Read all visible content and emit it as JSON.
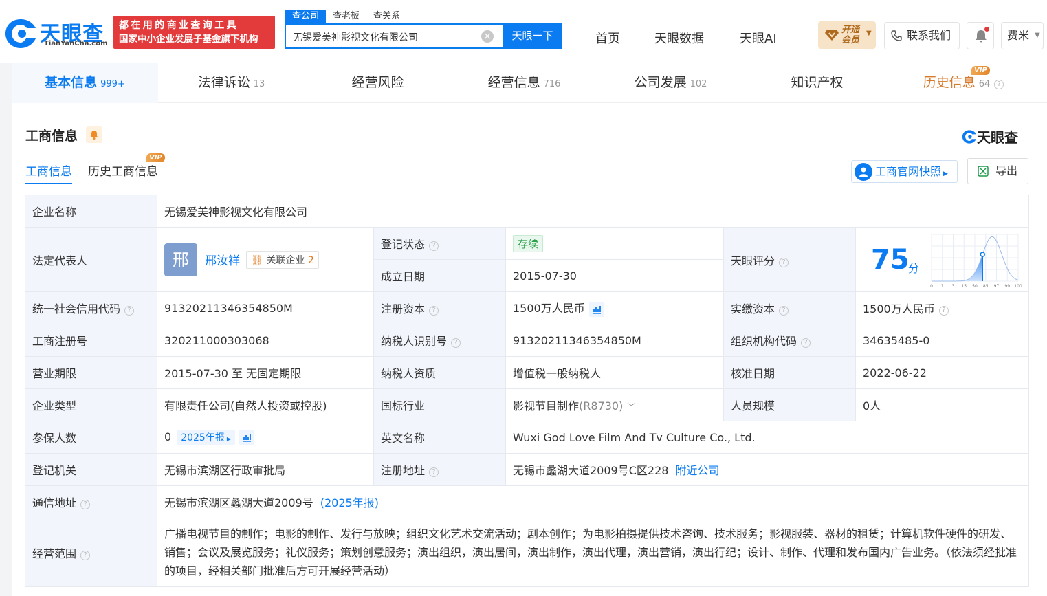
{
  "header": {
    "logo_cn": "天眼查",
    "logo_en": "TianYanCha.com",
    "slogan_1": "都在用的商业查询工具",
    "slogan_2": "国家中小企业发展子基金旗下机构",
    "search_tabs": [
      "查公司",
      "查老板",
      "查关系"
    ],
    "search_value": "无锡爱美神影视文化有限公司",
    "search_button": "天眼一下",
    "nav": [
      "首页",
      "天眼数据",
      "天眼AI"
    ],
    "vip_l1": "开通",
    "vip_l2": "会员",
    "contact": "联系我们",
    "user": "费米"
  },
  "tabs": [
    {
      "label": "基本信息",
      "count": "999+"
    },
    {
      "label": "法律诉讼",
      "count": "13"
    },
    {
      "label": "经营风险",
      "count": ""
    },
    {
      "label": "经营信息",
      "count": "716"
    },
    {
      "label": "公司发展",
      "count": "102"
    },
    {
      "label": "知识产权",
      "count": ""
    },
    {
      "label": "历史信息",
      "count": "64",
      "vip": "VIP"
    }
  ],
  "section": {
    "title": "工商信息",
    "brand": "天眼查",
    "subtabs": [
      "工商信息",
      "历史工商信息"
    ],
    "vip": "VIP",
    "snapshot": "工商官网快照",
    "export": "导出"
  },
  "info": {
    "name_k": "企业名称",
    "name_v": "无锡爱美神影视文化有限公司",
    "legal_k": "法定代表人",
    "legal_avatar": "邢",
    "legal_v": "邢汝祥",
    "related": "关联企业",
    "related_n": "2",
    "status_k": "登记状态",
    "status_v": "存续",
    "found_k": "成立日期",
    "found_v": "2015-07-30",
    "score_k": "天眼评分",
    "score_v": "75",
    "score_u": "分",
    "credit_k": "统一社会信用代码",
    "credit_v": "91320211346354850M",
    "capital_k": "注册资本",
    "capital_v": "1500万人民币",
    "paid_k": "实缴资本",
    "paid_v": "1500万人民币",
    "reg_k": "工商注册号",
    "reg_v": "320211000303068",
    "tax_k": "纳税人识别号",
    "tax_v": "91320211346354850M",
    "org_k": "组织机构代码",
    "org_v": "34635485-0",
    "term_k": "营业期限",
    "term_v": "2015-07-30 至 无固定期限",
    "taxq_k": "纳税人资质",
    "taxq_v": "增值税一般纳税人",
    "approve_k": "核准日期",
    "approve_v": "2022-06-22",
    "type_k": "企业类型",
    "type_v": "有限责任公司(自然人投资或控股)",
    "ind_k": "国标行业",
    "ind_v": "影视节目制作",
    "ind_code": "(R8730)",
    "staff_k": "人员规模",
    "staff_v": "0人",
    "ins_k": "参保人数",
    "ins_v": "0",
    "ins_rep": "2025年报",
    "en_k": "英文名称",
    "en_v": "Wuxi God Love Film And Tv Culture Co., Ltd.",
    "auth_k": "登记机关",
    "auth_v": "无锡市滨湖区行政审批局",
    "addr_k": "注册地址",
    "addr_v": "无锡市蠡湖大道2009号C区228",
    "addr_link": "附近公司",
    "mail_k": "通信地址",
    "mail_v": "无锡市滨湖区蠡湖大道2009号",
    "mail_rep": "(2025年报)",
    "scope_k": "经营范围",
    "scope_v": "广播电视节目的制作；电影的制作、发行与放映；组织文化艺术交流活动；剧本创作；为电影拍摄提供技术咨询、技术服务；影视服装、器材的租赁；计算机软件硬件的研发、销售；会议及展览服务；礼仪服务；策划创意服务；演出组织，演出居间，演出制作，演出代理，演出营销，演出行纪；设计、制作、代理和发布国内广告业务。（依法须经批准的项目，经相关部门批准后方可开展经营活动）"
  },
  "score_chart": {
    "ticks": [
      "0",
      "1",
      "3",
      "15",
      "50",
      "85",
      "97",
      "99",
      "100"
    ],
    "value": 75
  },
  "colors": {
    "accent": "#0b7bf1",
    "slogan": "#e33b3b",
    "status": "#2aa04a",
    "vip": "#d97a2b"
  }
}
